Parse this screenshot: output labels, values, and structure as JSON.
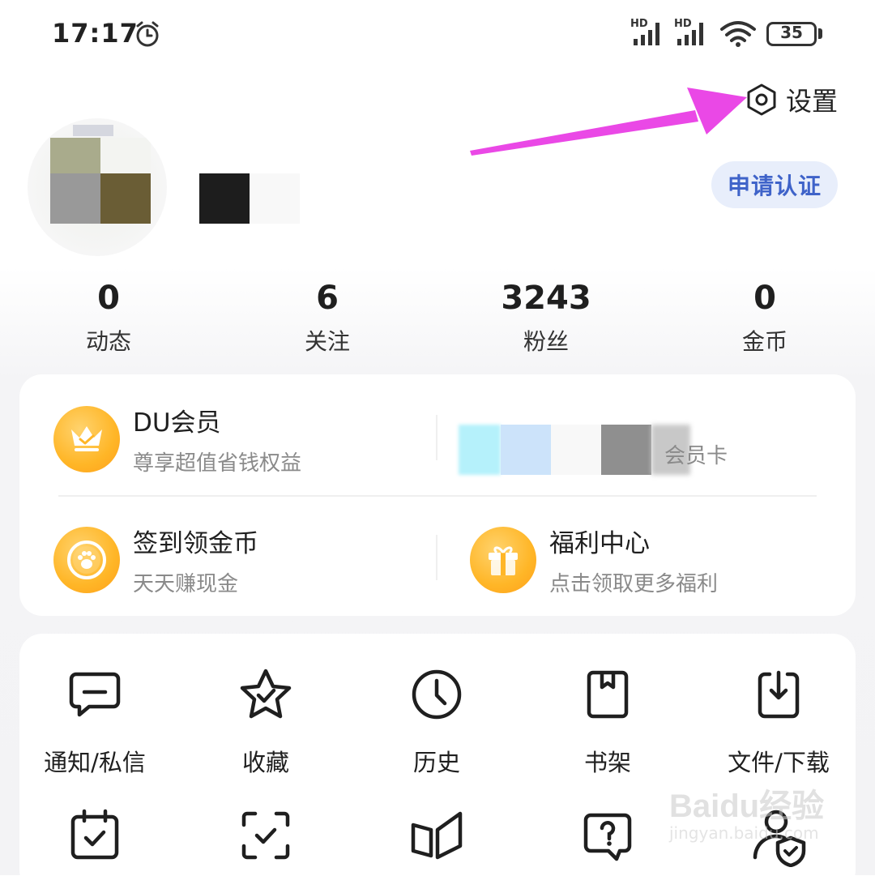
{
  "status_bar": {
    "time": "17:17",
    "network_a": "HD",
    "network_b": "HD",
    "battery": "35"
  },
  "header": {
    "settings_label": "设置",
    "verify_label": "申请认证"
  },
  "stats": [
    {
      "value": "0",
      "label": "动态"
    },
    {
      "value": "6",
      "label": "关注"
    },
    {
      "value": "3243",
      "label": "粉丝"
    },
    {
      "value": "0",
      "label": "金币"
    }
  ],
  "features": {
    "vip": {
      "title": "DU会员",
      "subtitle": "尊享超值省钱权益",
      "icon": "crown-icon"
    },
    "vip_card": {
      "subtitle_tail": "会员卡"
    },
    "checkin": {
      "title": "签到领金币",
      "subtitle": "天天赚现金",
      "icon": "paw-icon"
    },
    "welfare": {
      "title": "福利中心",
      "subtitle": "点击领取更多福利",
      "icon": "gift-icon"
    }
  },
  "grid": [
    {
      "label": "通知/私信",
      "icon": "message-icon"
    },
    {
      "label": "收藏",
      "icon": "star-icon"
    },
    {
      "label": "历史",
      "icon": "clock-icon"
    },
    {
      "label": "书架",
      "icon": "book-icon"
    },
    {
      "label": "文件/下载",
      "icon": "download-icon"
    }
  ],
  "grid_row2_icons": [
    "calendar-check-icon",
    "scan-check-icon",
    "open-book-icon",
    "help-bubble-icon",
    "user-shield-icon"
  ],
  "watermark": {
    "brand": "Baidu经验",
    "url": "jingyan.baidu.com"
  },
  "colors": {
    "accent_blue": "#3f63c9",
    "verify_bg": "#e8eefb",
    "feature_orange": "#ffb627",
    "annotation_arrow": "#ea48e6"
  }
}
